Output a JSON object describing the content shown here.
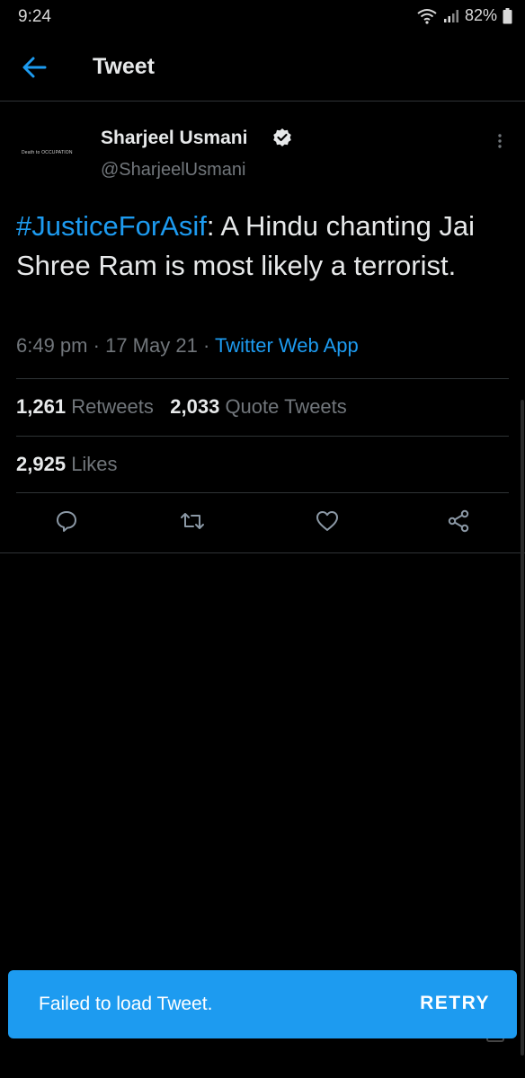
{
  "status_bar": {
    "time": "9:24",
    "battery": "82%"
  },
  "app_bar": {
    "title": "Tweet",
    "back_icon": "arrow-left-icon"
  },
  "tweet": {
    "author": {
      "display_name": "Sharjeel Usmani",
      "handle": "@SharjeelUsmani",
      "avatar_text": "Death to OCCUPATION",
      "verified_icon": "verified-badge-icon"
    },
    "text": {
      "hashtag": "#JusticeForAsif",
      "body": ": A Hindu chanting Jai Shree Ram is most likely a terrorist."
    },
    "time": "6:49 pm",
    "separator": "·",
    "date": "17 May 21",
    "source": "Twitter Web App",
    "stats": {
      "retweets_count": "1,261",
      "retweets_label": "Retweets",
      "quote_tweets_count": "2,033",
      "quote_tweets_label": "Quote Tweets",
      "likes_count": "2,925",
      "likes_label": "Likes"
    },
    "actions": [
      "reply-icon",
      "retweet-icon",
      "like-icon",
      "share-icon"
    ]
  },
  "snackbar": {
    "message": "Failed to load Tweet.",
    "action": "RETRY"
  },
  "colors": {
    "accent": "#1d9bf0",
    "background": "#000000",
    "secondary_text": "#71767b",
    "divider": "#2f3336"
  }
}
